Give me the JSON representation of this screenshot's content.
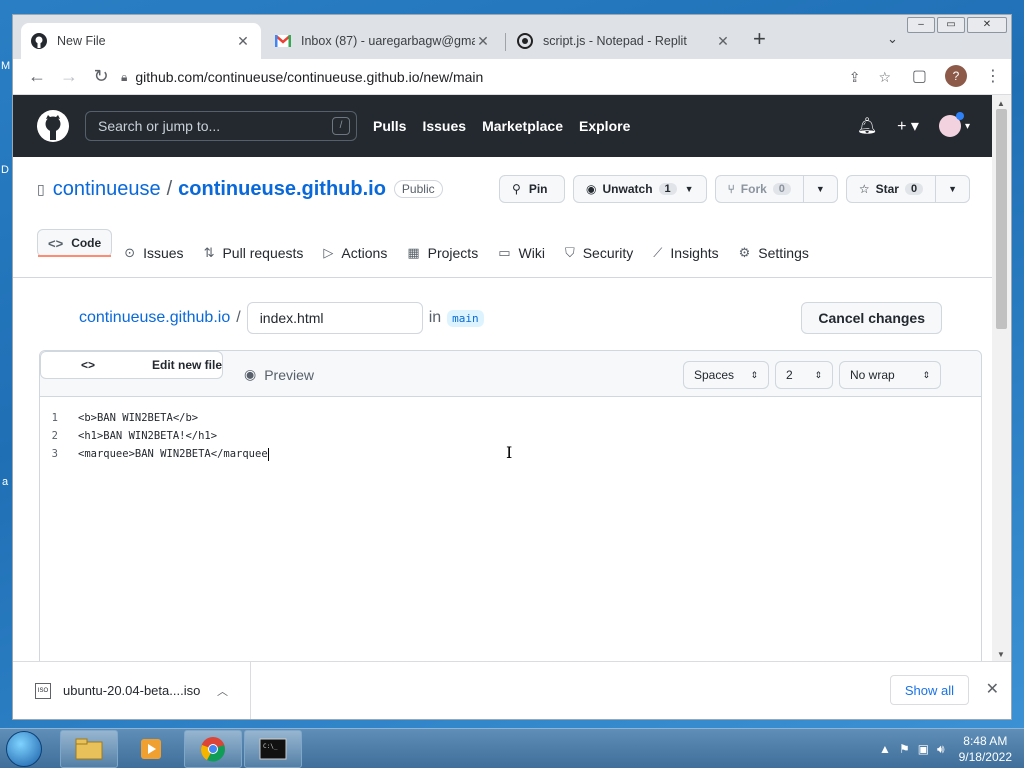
{
  "browser": {
    "tabs": [
      {
        "title": "New File",
        "icon": "github-icon"
      },
      {
        "title": "Inbox (87) - uaregarbagw@gmail",
        "icon": "gmail-icon"
      },
      {
        "title": "script.js - Notepad - Replit",
        "icon": "replit-icon"
      }
    ],
    "url": "github.com/continueuse/continueuse.github.io/new/main",
    "profile_initial": "?"
  },
  "github": {
    "search_placeholder": "Search or jump to...",
    "search_key": "/",
    "nav": [
      "Pulls",
      "Issues",
      "Marketplace",
      "Explore"
    ],
    "owner": "continueuse",
    "repo": "continueuse.github.io",
    "visibility": "Public",
    "pin_label": "Pin",
    "unwatch_label": "Unwatch",
    "watch_count": "1",
    "fork_label": "Fork",
    "fork_count": "0",
    "star_label": "Star",
    "star_count": "0",
    "repo_tabs": [
      {
        "label": "Code",
        "icon": "code-icon"
      },
      {
        "label": "Issues",
        "icon": "issues-icon"
      },
      {
        "label": "Pull requests",
        "icon": "pull-request-icon"
      },
      {
        "label": "Actions",
        "icon": "actions-icon"
      },
      {
        "label": "Projects",
        "icon": "projects-icon"
      },
      {
        "label": "Wiki",
        "icon": "wiki-icon"
      },
      {
        "label": "Security",
        "icon": "security-icon"
      },
      {
        "label": "Insights",
        "icon": "insights-icon"
      },
      {
        "label": "Settings",
        "icon": "settings-icon"
      }
    ]
  },
  "editor": {
    "path_repo": "continueuse.github.io",
    "path_sep": "/",
    "filename": "index.html",
    "in_label": "in",
    "branch": "main",
    "cancel_label": "Cancel changes",
    "edit_tab": "Edit new file",
    "preview_tab": "Preview",
    "indent_mode": "Spaces",
    "indent_size": "2",
    "wrap_mode": "No wrap",
    "lines": [
      {
        "n": "1",
        "text": "<b>BAN WIN2BETA</b>"
      },
      {
        "n": "2",
        "text": "<h1>BAN WIN2BETA!</h1>"
      },
      {
        "n": "3",
        "text": "<marquee>BAN WIN2BETA</marquee"
      }
    ]
  },
  "downloads": {
    "file": "ubuntu-20.04-beta....iso",
    "show_all": "Show all"
  },
  "taskbar": {
    "time": "8:48 AM",
    "date": "9/18/2022"
  },
  "desktop": {
    "edge_letters": [
      "M",
      "D",
      "a"
    ]
  }
}
